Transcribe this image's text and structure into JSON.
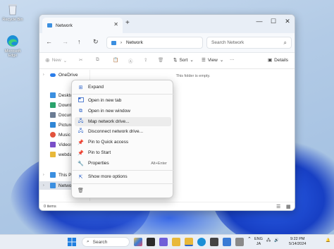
{
  "desktop": {
    "icons": [
      {
        "label": "Recycle Bin",
        "icon": "recycle-bin-icon"
      },
      {
        "label": "Microsoft Edge",
        "icon": "edge-icon"
      }
    ]
  },
  "window": {
    "tab_title": "Network",
    "new_tab_symbol": "+",
    "controls": {
      "minimize": "—",
      "maximize": "☐",
      "close": "✕"
    },
    "address": {
      "path": "Network"
    },
    "search": {
      "placeholder": "Search Network"
    },
    "command_bar": {
      "new_label": "New",
      "sort_label": "Sort",
      "view_label": "View",
      "more_label": "···",
      "details_label": "Details"
    },
    "nav_pane": [
      {
        "label": "OneDrive",
        "icon": "cloud-icon",
        "color": "#2b7de9"
      },
      {
        "label": "Desktop",
        "icon": "desktop-icon",
        "color": "#3b8fe0"
      },
      {
        "label": "Downloads",
        "icon": "download-icon",
        "color": "#2aa36b"
      },
      {
        "label": "Documents",
        "icon": "document-icon",
        "color": "#6b7c93"
      },
      {
        "label": "Pictures",
        "icon": "picture-icon",
        "color": "#2f86d6"
      },
      {
        "label": "Music",
        "icon": "music-icon",
        "color": "#e2533d"
      },
      {
        "label": "Videos",
        "icon": "video-icon",
        "color": "#7a4fc8"
      },
      {
        "label": "webdav",
        "icon": "folder-icon",
        "color": "#e8b83a"
      },
      {
        "label": "This PC",
        "icon": "computer-icon",
        "color": "#3b8fe0"
      },
      {
        "label": "Network",
        "icon": "network-icon",
        "color": "#3b8fe0"
      }
    ],
    "empty_message": "This folder is empty.",
    "status_count": "0 items"
  },
  "context_menu": {
    "items": [
      {
        "label": "Expand",
        "icon": "expand-icon",
        "glyph": "⊞"
      },
      {
        "label": "Open in new tab",
        "icon": "new-tab-icon",
        "glyph": ""
      },
      {
        "label": "Open in new window",
        "icon": "new-window-icon",
        "glyph": "⧉"
      },
      {
        "label": "Map network drive...",
        "icon": "map-drive-icon",
        "glyph": "🖧"
      },
      {
        "label": "Disconnect network drive...",
        "icon": "disconnect-drive-icon",
        "glyph": "🖧"
      },
      {
        "label": "Pin to Quick access",
        "icon": "pin-icon",
        "glyph": "📌"
      },
      {
        "label": "Pin to Start",
        "icon": "pin-start-icon",
        "glyph": "📌"
      },
      {
        "label": "Properties",
        "icon": "properties-icon",
        "glyph": "🔧",
        "shortcut": "Alt+Enter"
      },
      {
        "label": "Show more options",
        "icon": "more-options-icon",
        "glyph": "⇱"
      }
    ]
  },
  "taskbar": {
    "search_label": "Search",
    "tray": {
      "language_top": "ENG",
      "language_bottom": "JA",
      "time": "9:22 PM",
      "date": "5/14/2024"
    }
  },
  "colors": {
    "accent": "#2d63c8",
    "wallpaper_blue": "#1f46c8"
  }
}
